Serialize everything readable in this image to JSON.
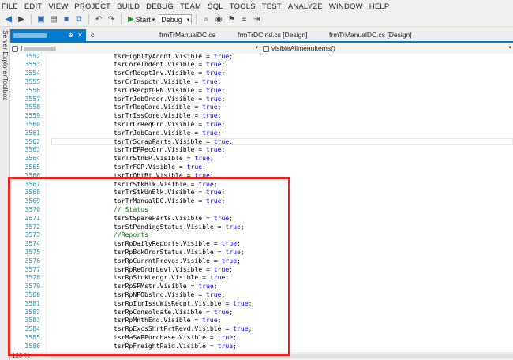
{
  "menu": [
    "FILE",
    "EDIT",
    "VIEW",
    "PROJECT",
    "BUILD",
    "DEBUG",
    "TEAM",
    "SQL",
    "TOOLS",
    "TEST",
    "ANALYZE",
    "WINDOW",
    "HELP"
  ],
  "toolbar": {
    "start_label": "Start",
    "configuration": "Debug",
    "icons": [
      "back-icon",
      "forward-icon",
      "new-project-icon",
      "open-icon",
      "save-icon",
      "save-all-icon",
      "undo-icon",
      "redo-icon",
      "start-icon",
      "find-icon",
      "breakpoint-icon"
    ]
  },
  "left_panel": {
    "server_explorer": "Server Explorer",
    "toolbox": "Toolbox"
  },
  "tabs": [
    {
      "label": "frmTrManualDC.cs"
    },
    {
      "label": "frmTrDCInd.cs [Design]"
    },
    {
      "label": "frmTrManualDC.cs [Design]"
    }
  ],
  "navbar": {
    "class_combo": "f",
    "member_combo": "visibleAllmenuItems()"
  },
  "editor": {
    "lines": [
      {
        "n": "3552",
        "code": "tsrElgbltyAccnt.Visible",
        "val": "true"
      },
      {
        "n": "3553",
        "code": "tsrCoreIndent.Visible",
        "val": "true"
      },
      {
        "n": "3554",
        "code": "tsrCrRecptInv.Visible",
        "val": "true"
      },
      {
        "n": "3555",
        "code": "tsrCrInspctn.Visible",
        "val": "true"
      },
      {
        "n": "3556",
        "code": "tsrCrRecptGRN.Visible",
        "val": "true"
      },
      {
        "n": "3557",
        "code": "tsrTrJobOrder.Visible",
        "val": "true"
      },
      {
        "n": "3558",
        "code": "tsrTrReqCore.Visible",
        "val": "true"
      },
      {
        "n": "3559",
        "code": "tsrTrIssCore.Visible",
        "val": "true"
      },
      {
        "n": "3560",
        "code": "tsrTrCrReqGrn.Visible",
        "val": "true"
      },
      {
        "n": "3561",
        "code": "tsrTrJobCard.Visible",
        "val": "true"
      },
      {
        "n": "3562",
        "code": "tsrTrScrapParts.Visible",
        "val": "true"
      },
      {
        "n": "3563",
        "code": "tsrTrEPRecGrn.Visible",
        "val": "true"
      },
      {
        "n": "3564",
        "code": "tsrTrStnEP.Visible",
        "val": "true"
      },
      {
        "n": "3565",
        "code": "tsrTrFGP.Visible",
        "val": "true"
      },
      {
        "n": "3566",
        "code": "tsrTrObtBt.Visible",
        "val": "true"
      },
      {
        "n": "3567",
        "code": "tsrTrStkBlk.Visible",
        "val": "true"
      },
      {
        "n": "3568",
        "code": "tsrTrStkUnBlk.Visible",
        "val": "true"
      },
      {
        "n": "3569",
        "code": "tsrTrManualDC.Visible",
        "val": "true"
      },
      {
        "n": "3570",
        "comment": "// Status"
      },
      {
        "n": "3571",
        "code": "tsrStSpareParts.Visible",
        "val": "true"
      },
      {
        "n": "3572",
        "code": "tsrStPendingStatus.Visible",
        "val": "true"
      },
      {
        "n": "3573",
        "comment": "//Reports"
      },
      {
        "n": "3574",
        "code": "tsrRpDailyReports.Visible",
        "val": "true"
      },
      {
        "n": "3575",
        "code": "tsrRpBckOrdrStatus.Visible",
        "val": "true"
      },
      {
        "n": "3576",
        "code": "tsrRpCurrntPrevos.Visible",
        "val": "true"
      },
      {
        "n": "3577",
        "code": "tsrRpReOrdrLevl.Visible",
        "val": "true"
      },
      {
        "n": "3578",
        "code": "tsrRpStckLedgr.Visible",
        "val": "true"
      },
      {
        "n": "3579",
        "code": "tsrRpSPMstr.Visible",
        "val": "true"
      },
      {
        "n": "3580",
        "code": "tsrRpNPObslnc.Visible",
        "val": "true"
      },
      {
        "n": "3581",
        "code": "tsrRpItmIssuWisRecpt.Visible",
        "val": "true"
      },
      {
        "n": "3582",
        "code": "tsrRpConsoldate.Visible",
        "val": "true"
      },
      {
        "n": "3583",
        "code": "tsrRpMnthEnd.Visible",
        "val": "true"
      },
      {
        "n": "3584",
        "code": "tsrRpExcsShrtPrtRevd.Visible",
        "val": "true"
      },
      {
        "n": "3585",
        "code": "tsrMaSWPPurchase.Visible",
        "val": "true"
      },
      {
        "n": "3586",
        "code": "tsrRpFreightPaid.Visible",
        "val": "true"
      }
    ]
  },
  "statusbar": {
    "zoom": "100 %"
  },
  "colors": {
    "accent": "#007acc",
    "keyword": "#0000ff",
    "comment": "#008000",
    "line_number": "#2b91af",
    "highlight_box": "#e8231c"
  }
}
